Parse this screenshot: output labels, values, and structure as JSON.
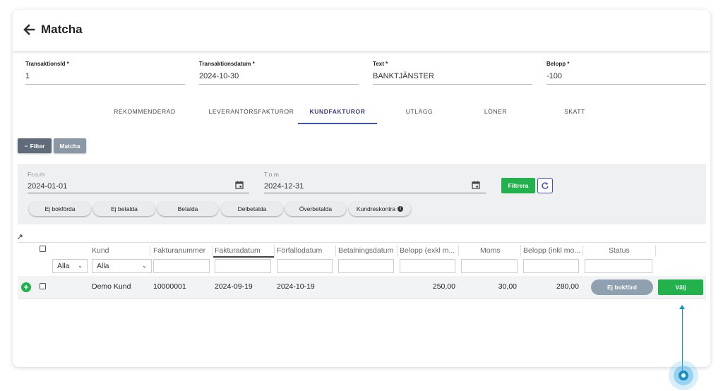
{
  "header": {
    "title": "Matcha",
    "back_icon": "arrow-left-icon"
  },
  "fields": [
    {
      "label": "TransaktionsId *",
      "value": "1"
    },
    {
      "label": "Transaktionsdatum *",
      "value": "2024-10-30"
    },
    {
      "label": "Text *",
      "value": "BANKTJÄNSTER"
    },
    {
      "label": "Belopp *",
      "value": "-100"
    }
  ],
  "tabs": [
    {
      "label": "REKOMMENDERAD"
    },
    {
      "label": "LEVERANTÖRSFAKTUROR"
    },
    {
      "label": "KUNDFAKTUROR",
      "active": true
    },
    {
      "label": "UTLÄGG"
    },
    {
      "label": "LÖNER"
    },
    {
      "label": "SKATT"
    }
  ],
  "toolbar": {
    "filter_label": "Filter",
    "filter_symbol": "−",
    "matcha_label": "Matcha"
  },
  "filter": {
    "from_label": "Fr.o.m",
    "from_value": "2024-01-01",
    "to_label": "T.o.m",
    "to_value": "2024-12-31",
    "filtrera_label": "Filtrera",
    "chips": [
      "Ej bokförda",
      "Ej betalda",
      "Betalda",
      "Delbetalda",
      "Överbetalda",
      "Kundreskontra"
    ],
    "info_symbol": "i"
  },
  "table": {
    "headers": [
      "Kund",
      "Fakturanummer",
      "Fakturadatum",
      "Förfallodatum",
      "Betalningsdatum",
      "Belopp (exkl m...",
      "Moms",
      "Belopp (inkl mo...",
      "Status"
    ],
    "filter_selects": [
      "Alla",
      "Alla"
    ],
    "rows": [
      {
        "kund": "Demo Kund",
        "fakturanummer": "10000001",
        "fakturadatum": "2024-09-19",
        "forfallodatum": "2024-10-19",
        "betalningsdatum": "",
        "belopp_exkl": "250,00",
        "moms": "30,00",
        "belopp_inkl": "280,00",
        "status": "Ej bokförd",
        "action": "Välj",
        "expand_symbol": "+"
      }
    ]
  },
  "colors": {
    "green": "#22b14c",
    "accent": "#3f51b5",
    "badge": "#8fa0b1",
    "pointer": "#1a8fc4"
  }
}
